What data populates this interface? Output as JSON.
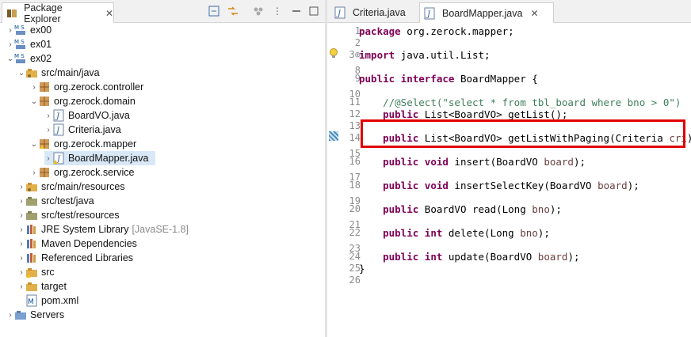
{
  "explorer": {
    "title": "Package Explorer",
    "items": [
      {
        "label": "ex00"
      },
      {
        "label": "ex01"
      },
      {
        "label": "ex02"
      },
      {
        "label": "src/main/java"
      },
      {
        "label": "org.zerock.controller"
      },
      {
        "label": "org.zerock.domain"
      },
      {
        "label": "BoardVO.java"
      },
      {
        "label": "Criteria.java"
      },
      {
        "label": "org.zerock.mapper"
      },
      {
        "label": "BoardMapper.java"
      },
      {
        "label": "org.zerock.service"
      },
      {
        "label": "src/main/resources"
      },
      {
        "label": "src/test/java"
      },
      {
        "label": "src/test/resources"
      },
      {
        "label": "JRE System Library",
        "suffix": "[JavaSE-1.8]"
      },
      {
        "label": "Maven Dependencies"
      },
      {
        "label": "Referenced Libraries"
      },
      {
        "label": "src"
      },
      {
        "label": "target"
      },
      {
        "label": "pom.xml"
      },
      {
        "label": "Servers"
      }
    ]
  },
  "editor": {
    "tabs": [
      {
        "label": "Criteria.java"
      },
      {
        "label": "BoardMapper.java"
      }
    ],
    "lines": [
      {
        "num": "1",
        "parts": [
          {
            "k": "kw",
            "t": "package"
          },
          {
            "t": " org.zerock.mapper;"
          }
        ]
      },
      {
        "num": "2",
        "parts": []
      },
      {
        "num": "3⊕",
        "parts": [
          {
            "k": "kw",
            "t": "import"
          },
          {
            "t": " java.util.List;"
          }
        ]
      },
      {
        "num": "8",
        "parts": []
      },
      {
        "num": "9",
        "parts": [
          {
            "k": "kw",
            "t": "public interface"
          },
          {
            "t": " BoardMapper {"
          }
        ]
      },
      {
        "num": "10",
        "parts": []
      },
      {
        "num": "11",
        "parts": [
          {
            "t": "    "
          },
          {
            "k": "cm",
            "t": "//@Select(\"select * from tbl_board where bno > 0\")"
          }
        ]
      },
      {
        "num": "12",
        "parts": [
          {
            "t": "    "
          },
          {
            "k": "kw",
            "t": "public"
          },
          {
            "t": " List<BoardVO> getList();"
          }
        ]
      },
      {
        "num": "13",
        "parts": []
      },
      {
        "num": "14",
        "parts": [
          {
            "t": "    "
          },
          {
            "k": "kw",
            "t": "public"
          },
          {
            "t": " List<BoardVO> getListWithPaging(Criteria "
          },
          {
            "k": "pm",
            "t": "cri"
          },
          {
            "t": ");"
          }
        ]
      },
      {
        "num": "15",
        "parts": []
      },
      {
        "num": "16",
        "parts": [
          {
            "t": "    "
          },
          {
            "k": "kw",
            "t": "public void"
          },
          {
            "t": " insert(BoardVO "
          },
          {
            "k": "pm",
            "t": "board"
          },
          {
            "t": ");"
          }
        ]
      },
      {
        "num": "17",
        "parts": []
      },
      {
        "num": "18",
        "parts": [
          {
            "t": "    "
          },
          {
            "k": "kw",
            "t": "public void"
          },
          {
            "t": " insertSelectKey(BoardVO "
          },
          {
            "k": "pm",
            "t": "board"
          },
          {
            "t": ");"
          }
        ]
      },
      {
        "num": "19",
        "parts": []
      },
      {
        "num": "20",
        "parts": [
          {
            "t": "    "
          },
          {
            "k": "kw",
            "t": "public"
          },
          {
            "t": " BoardVO read(Long "
          },
          {
            "k": "pm",
            "t": "bno"
          },
          {
            "t": ");"
          }
        ]
      },
      {
        "num": "21",
        "parts": []
      },
      {
        "num": "22",
        "parts": [
          {
            "t": "    "
          },
          {
            "k": "kw",
            "t": "public int"
          },
          {
            "t": " delete(Long "
          },
          {
            "k": "pm",
            "t": "bno"
          },
          {
            "t": ");"
          }
        ]
      },
      {
        "num": "23",
        "parts": []
      },
      {
        "num": "24",
        "parts": [
          {
            "t": "    "
          },
          {
            "k": "kw",
            "t": "public int"
          },
          {
            "t": " update(BoardVO "
          },
          {
            "k": "pm",
            "t": "board"
          },
          {
            "t": ");"
          }
        ]
      },
      {
        "num": "25",
        "parts": [
          {
            "t": "}"
          }
        ]
      },
      {
        "num": "26",
        "parts": []
      }
    ]
  },
  "colors": {
    "highlight": "#e00000",
    "keyword": "#7f0055",
    "comment": "#3f7f5f"
  }
}
